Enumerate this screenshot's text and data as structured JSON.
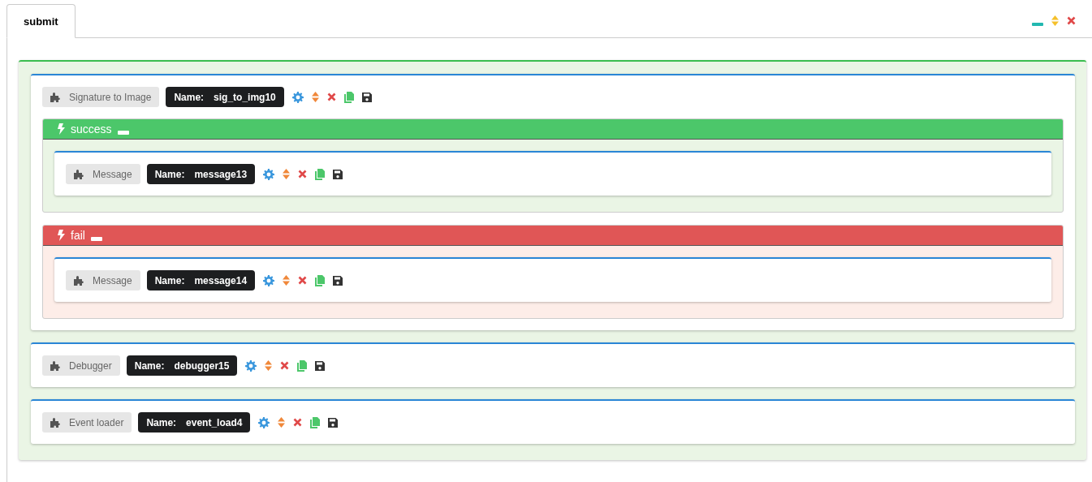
{
  "tabs": [
    {
      "label": "submit",
      "selected": true
    }
  ],
  "blocks": [
    {
      "type": "Signature to Image",
      "name_label": "Name:",
      "name": "sig_to_img10",
      "branches": [
        {
          "kind": "success",
          "label": "success",
          "blocks": [
            {
              "type": "Message",
              "name_label": "Name:",
              "name": "message13"
            }
          ]
        },
        {
          "kind": "fail",
          "label": "fail",
          "blocks": [
            {
              "type": "Message",
              "name_label": "Name:",
              "name": "message14"
            }
          ]
        }
      ]
    },
    {
      "type": "Debugger",
      "name_label": "Name:",
      "name": "debugger15"
    },
    {
      "type": "Event loader",
      "name_label": "Name:",
      "name": "event_load4"
    }
  ]
}
